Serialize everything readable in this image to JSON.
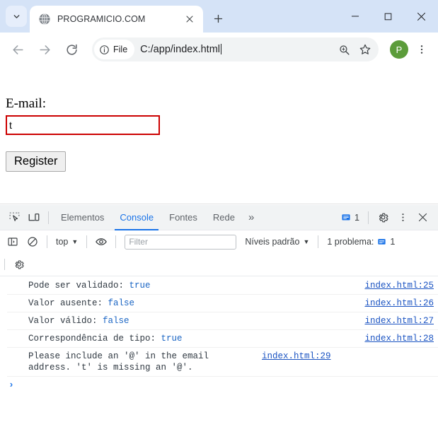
{
  "browser": {
    "tab": {
      "title": "PROGRAMICIO.COM",
      "favicon_icon": "globe-icon",
      "close_icon": "close-icon"
    },
    "tab_search_icon": "chevron-down-icon",
    "new_tab_icon": "plus-icon",
    "window_controls": {
      "minimize_icon": "minimize-icon",
      "maximize_icon": "maximize-icon",
      "close_icon": "close-icon"
    },
    "toolbar": {
      "back_icon": "back-arrow-icon",
      "forward_icon": "forward-arrow-icon",
      "reload_icon": "reload-icon",
      "site_info_icon": "info-circle-icon",
      "scheme_label": "File",
      "url": "C:/app/index.html",
      "zoom_icon": "zoom-in-icon",
      "bookmark_icon": "star-icon",
      "profile_initial": "P",
      "profile_color": "#5c9c3b",
      "menu_icon": "three-dots-vertical-icon"
    }
  },
  "page": {
    "email_label": "E-mail:",
    "email_value": "t",
    "email_placeholder": "",
    "email_border_color": "#cc0000",
    "register_label": "Register"
  },
  "devtools": {
    "inspect_icon": "inspect-element-icon",
    "device_icon": "device-toolbar-icon",
    "tabs": [
      {
        "label": "Elementos",
        "active": false
      },
      {
        "label": "Console",
        "active": true
      },
      {
        "label": "Fontes",
        "active": false
      },
      {
        "label": "Rede",
        "active": false
      }
    ],
    "overflow_label": "»",
    "message_count_icon": "message-badge-icon",
    "message_count": "1",
    "settings_icon": "gear-icon",
    "more_icon": "three-dots-vertical-icon",
    "close_icon": "close-icon",
    "active_tab_color": "#1a73e8",
    "console_toolbar": {
      "sidebar_icon": "console-sidebar-icon",
      "clear_icon": "clear-console-icon",
      "context": "top",
      "context_caret": "▼",
      "eye_icon": "live-expression-eye-icon",
      "filter_placeholder": "Filter",
      "filter_value": "",
      "levels_label": "Níveis padrão",
      "levels_caret": "▼",
      "problems_label": "1 problema:",
      "problems_icon": "message-badge-icon",
      "problems_count": "1",
      "settings_icon": "gear-icon"
    },
    "messages": [
      {
        "label": "Pode ser validado: ",
        "value": "true",
        "source": "index.html:25"
      },
      {
        "label": "Valor ausente: ",
        "value": "false",
        "source": "index.html:26"
      },
      {
        "label": "Valor válido: ",
        "value": "false",
        "source": "index.html:27"
      },
      {
        "label": "Correspondência de tipo: ",
        "value": "true",
        "source": "index.html:28"
      },
      {
        "label": "Please include an '@' in the email address. 't' is missing an '@'.",
        "value": "",
        "source": "index.html:29"
      }
    ],
    "prompt_chevron": "›"
  }
}
